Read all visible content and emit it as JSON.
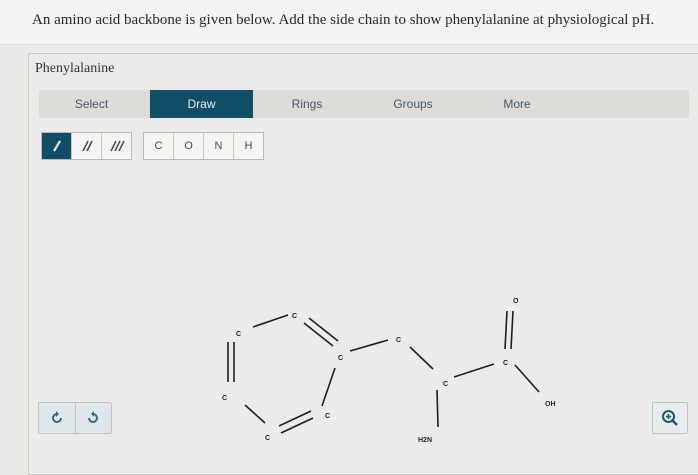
{
  "question": {
    "text": "An amino acid backbone is given below. Add the side chain to show phenylalanine at physiological pH."
  },
  "panel": {
    "title": "Phenylalanine"
  },
  "tabs": [
    {
      "label": "Select",
      "active": false
    },
    {
      "label": "Draw",
      "active": true
    },
    {
      "label": "Rings",
      "active": false
    },
    {
      "label": "Groups",
      "active": false
    },
    {
      "label": "More",
      "active": false
    }
  ],
  "bond_tools": [
    {
      "name": "single-bond",
      "glyph": "/",
      "active": true
    },
    {
      "name": "double-bond",
      "glyph": "//",
      "active": false
    },
    {
      "name": "triple-bond",
      "glyph": "///",
      "active": false
    }
  ],
  "atom_tools": [
    "C",
    "O",
    "N",
    "H"
  ],
  "molecule": {
    "atoms": {
      "ring_top": "C",
      "ring_upper_left": "C",
      "ring_lower_left": "C",
      "ring_bottom": "C",
      "ring_lower_right": "C",
      "ring_upper_right": "C",
      "ch2": "C",
      "alpha": "C",
      "carboxyl": "C",
      "carbonyl_o": "O",
      "hydroxyl": "OH",
      "amine": "H2N"
    }
  },
  "controls": {
    "undo_icon": "undo-icon",
    "redo_icon": "redo-icon",
    "zoom_icon": "zoom-in-icon"
  },
  "colors": {
    "accent": "#0f4e66",
    "icon": "#2a6f86"
  }
}
